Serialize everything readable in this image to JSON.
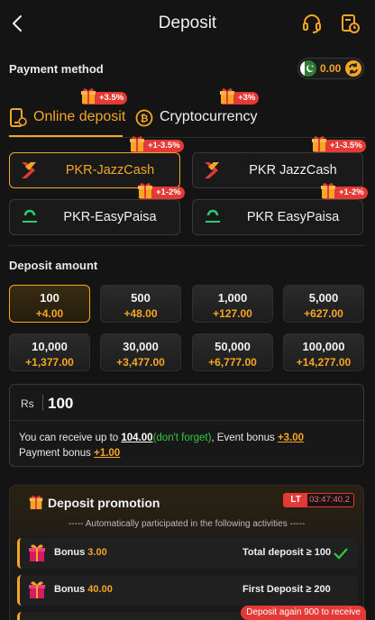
{
  "header": {
    "title": "Deposit",
    "back_icon": "back-arrow-icon",
    "support_icon": "headset-icon",
    "history_icon": "history-icon"
  },
  "payment": {
    "title": "Payment method",
    "balance": "0.00",
    "tabs": [
      {
        "label": "Online deposit",
        "badge": "+3.5%"
      },
      {
        "label": "Cryptocurrency",
        "badge": "+3%"
      }
    ],
    "channels": [
      {
        "name": "PKR-JazzCash",
        "badge": "+1-3.5%",
        "logo": "jazzcash-logo"
      },
      {
        "name": "PKR JazzCash",
        "badge": "+1-3.5%",
        "logo": "jazzcash-logo"
      },
      {
        "name": "PKR-EasyPaisa",
        "badge": "+1-2%",
        "logo": "easypaisa-logo"
      },
      {
        "name": "PKR EasyPaisa",
        "badge": "+1-2%",
        "logo": "easypaisa-logo"
      }
    ]
  },
  "amount": {
    "title": "Deposit amount",
    "options": [
      {
        "value": "100",
        "bonus": "+4.00"
      },
      {
        "value": "500",
        "bonus": "+48.00"
      },
      {
        "value": "1,000",
        "bonus": "+127.00"
      },
      {
        "value": "5,000",
        "bonus": "+627.00"
      },
      {
        "value": "10,000",
        "bonus": "+1,377.00"
      },
      {
        "value": "30,000",
        "bonus": "+3,477.00"
      },
      {
        "value": "50,000",
        "bonus": "+6,777.00"
      },
      {
        "value": "100,000",
        "bonus": "+14,277.00"
      }
    ],
    "currency": "Rs",
    "input_value": "100",
    "info": {
      "prefix": "You can receive up to ",
      "receive": "104.00",
      "dont_forget": "(don't forget)",
      "event_label": ", Event bonus ",
      "event_bonus": "+3.00",
      "payment_label": "Payment bonus ",
      "payment_bonus": "+1.00"
    }
  },
  "promotion": {
    "title": "Deposit promotion",
    "lt": "LT",
    "timer": "03:47:40.2",
    "subtitle": "----- Automatically participated in the following activities -----",
    "rows": [
      {
        "label": "Bonus",
        "value": "3.00",
        "condition": "Total deposit ≥ 100"
      },
      {
        "label": "Bonus",
        "value": "40.00",
        "condition": "First Deposit ≥ 200"
      }
    ],
    "again": "Deposit again 900 to receive"
  },
  "colors": {
    "accent": "#f5a623",
    "badge": "#e53935",
    "success": "#2ecc40",
    "background": "#141414"
  }
}
